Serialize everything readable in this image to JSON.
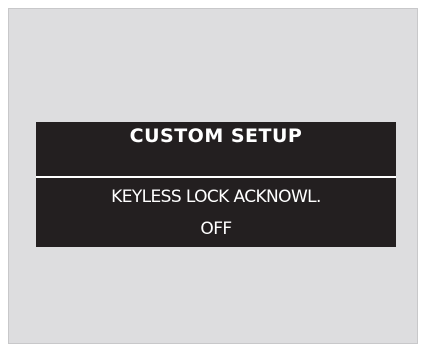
{
  "screen": {
    "title": "CUSTOM SETUP",
    "setting_name": "KEYLESS LOCK ACKNOWL.",
    "setting_value": "OFF"
  },
  "colors": {
    "background": "#dddddf",
    "display": "#231f20",
    "text": "#ffffff"
  }
}
